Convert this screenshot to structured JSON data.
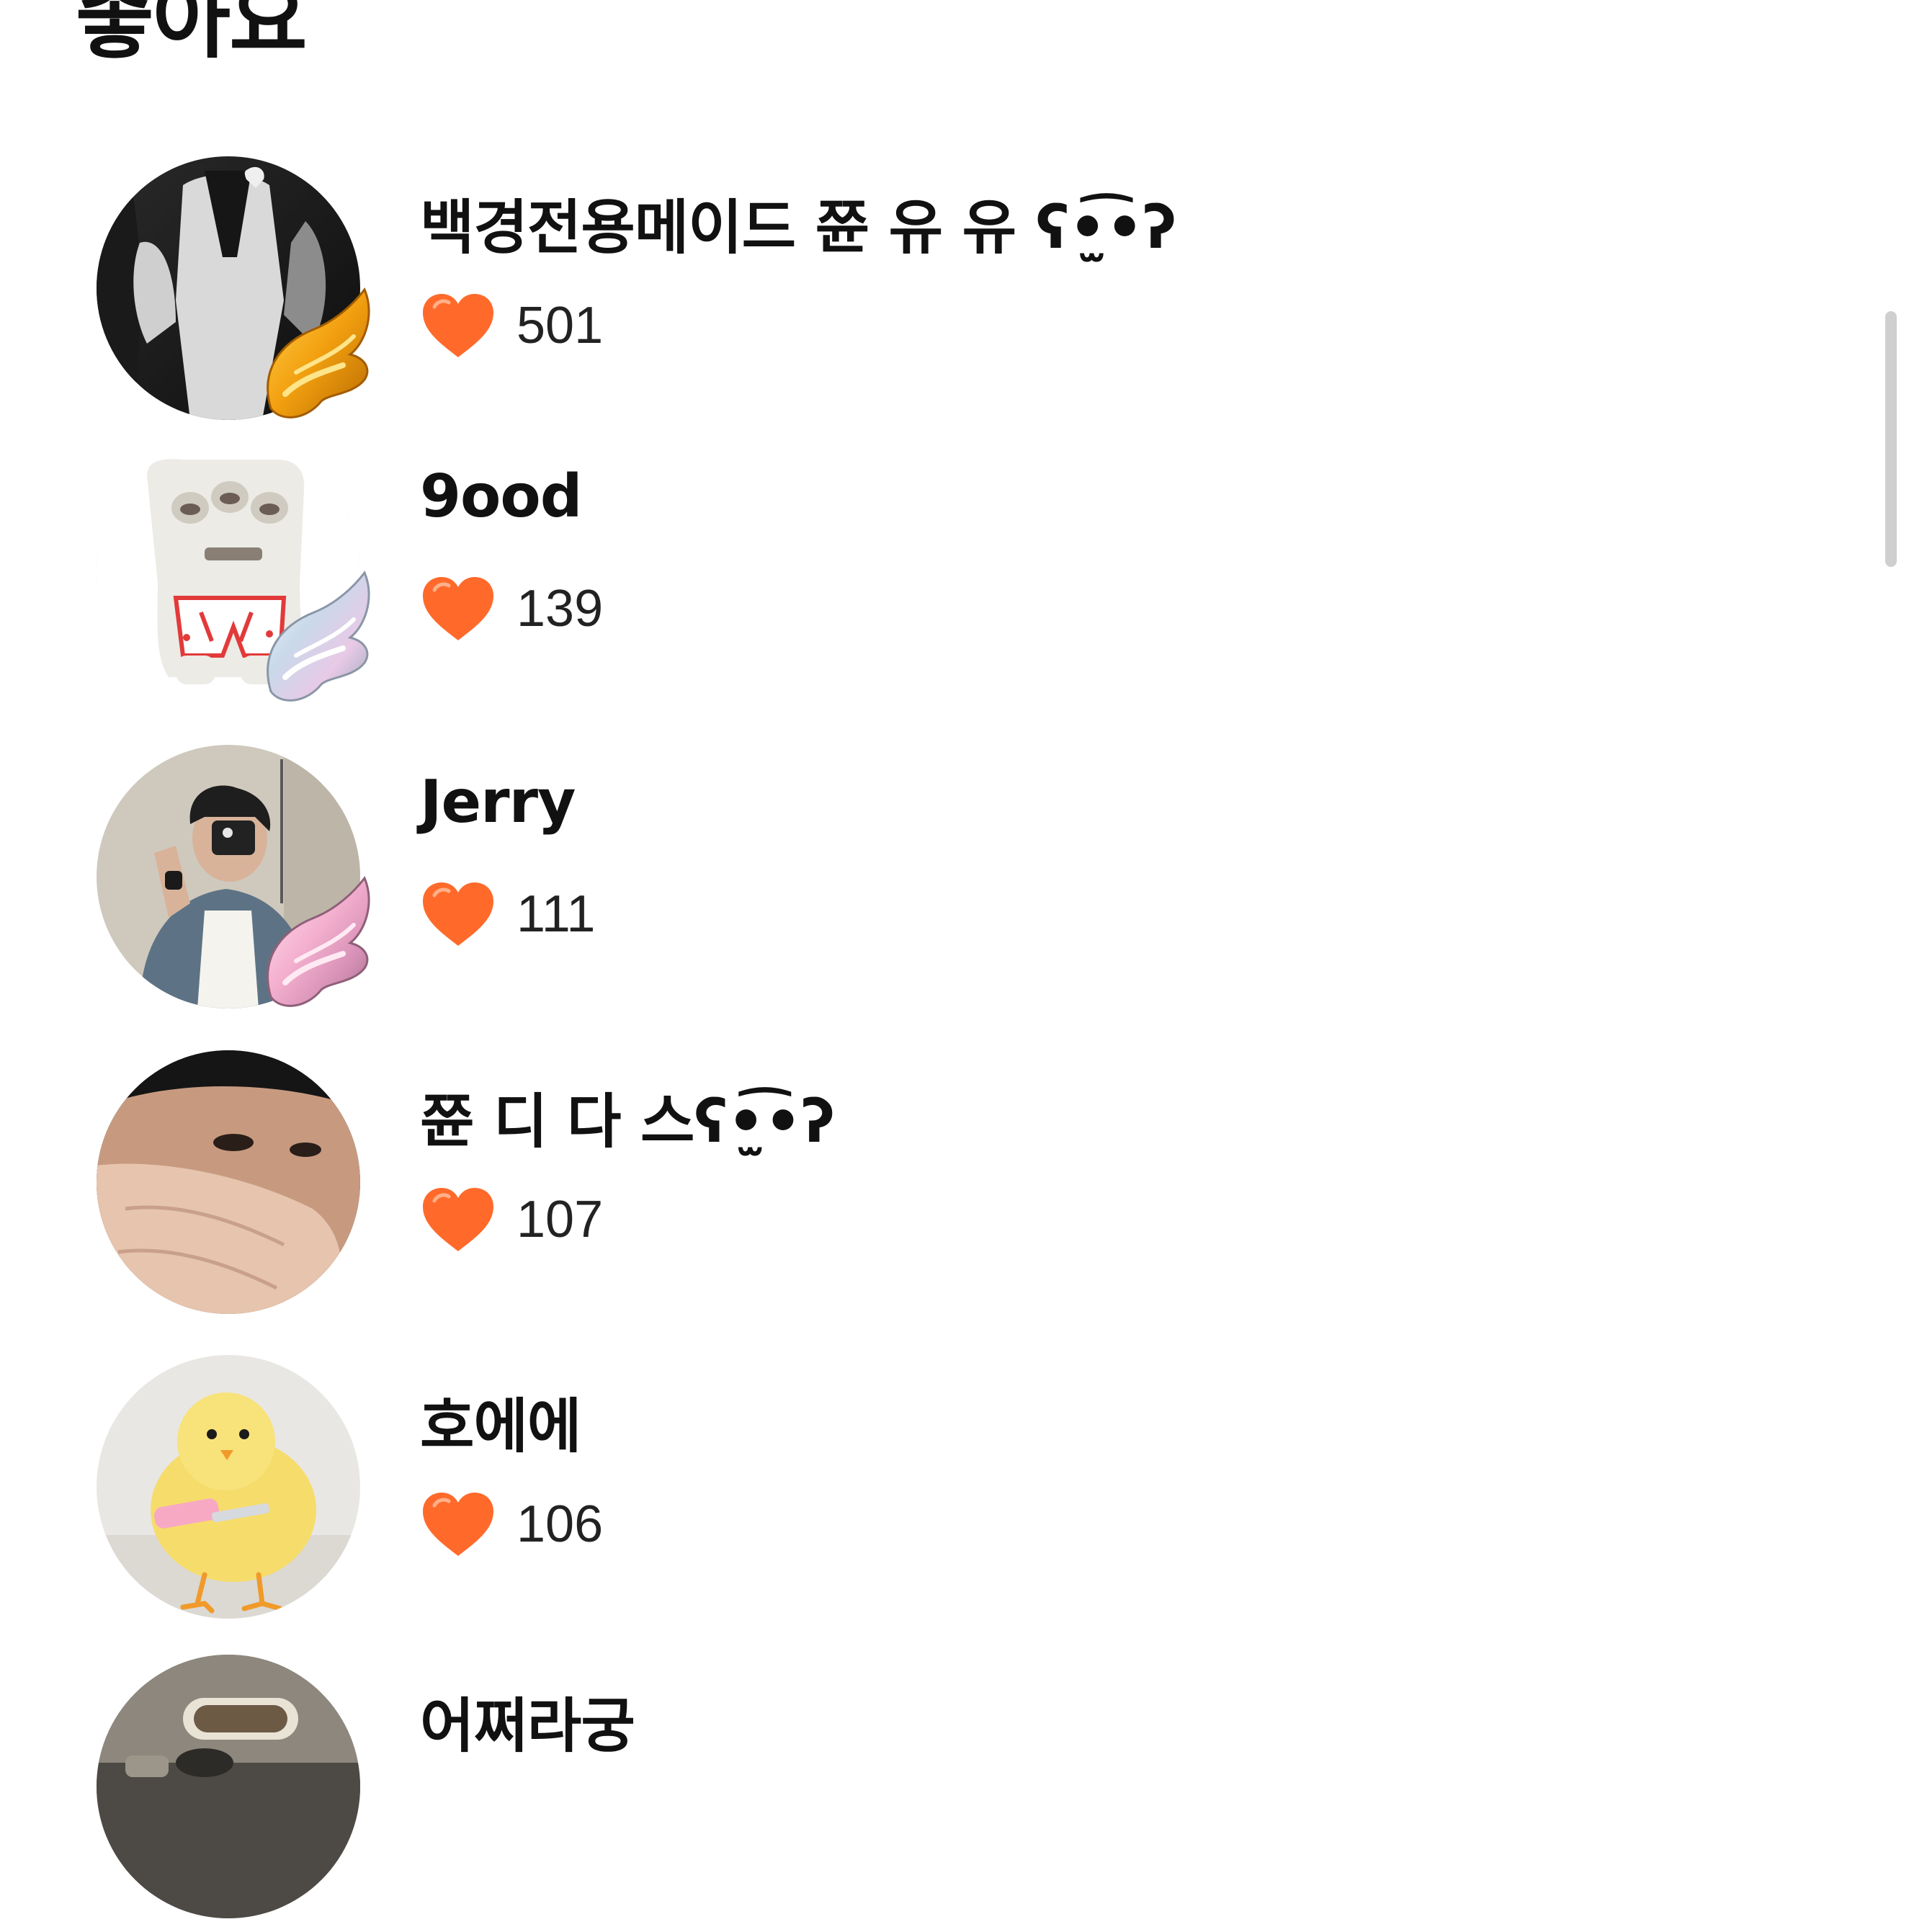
{
  "page": {
    "title": "좋아요"
  },
  "colors": {
    "heart": "#ff6a2b",
    "text": "#111111",
    "count": "#222222",
    "scrollbar": "#cfcfcf"
  },
  "likes": [
    {
      "name": "백경전용메이드 쮼 유 유 ʕ•̫͡•ʔ",
      "count": "501",
      "avatar": "dark-portrait-avatar",
      "badge": "gold-wing-badge"
    },
    {
      "name": "9ood",
      "count": "139",
      "avatar": "plush-monster-avatar",
      "badge": "silver-wing-badge"
    },
    {
      "name": "Jerry",
      "count": "111",
      "avatar": "mirror-selfie-avatar",
      "badge": "pink-wing-badge"
    },
    {
      "name": "쮼 디 다 스ʕ•̫͡•ʔ",
      "count": "107",
      "avatar": "face-closeup-avatar",
      "badge": ""
    },
    {
      "name": "호에에",
      "count": "106",
      "avatar": "chick-avatar",
      "badge": ""
    },
    {
      "name": "어쩌라궁",
      "count": "",
      "avatar": "room-avatar",
      "badge": ""
    }
  ]
}
